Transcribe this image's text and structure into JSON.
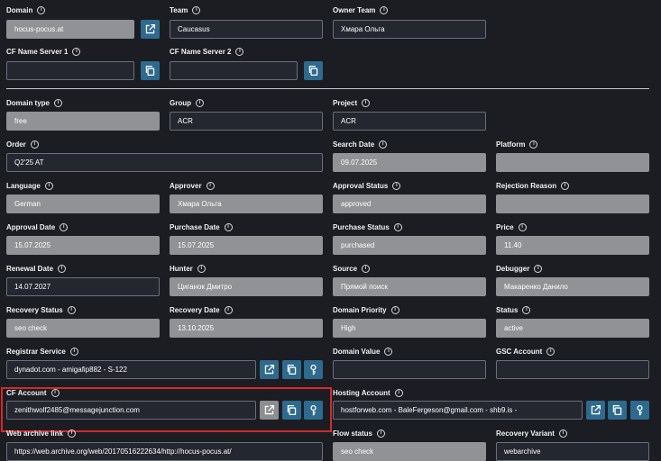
{
  "labels": {
    "domain": "Domain",
    "team": "Team",
    "owner_team": "Owner Team",
    "cf_ns1": "CF Name Server 1",
    "cf_ns2": "CF Name Server 2",
    "domain_type": "Domain type",
    "group": "Group",
    "project": "Project",
    "order": "Order",
    "search_date": "Search Date",
    "platform": "Platform",
    "language": "Language",
    "approver": "Approver",
    "approval_status": "Approval Status",
    "rejection_reason": "Rejection Reason",
    "approval_date": "Approval Date",
    "purchase_date": "Purchase Date",
    "purchase_status": "Purchase Status",
    "price": "Price",
    "renewal_date": "Renewal Date",
    "hunter": "Hunter",
    "source": "Source",
    "debugger": "Debugger",
    "recovery_status": "Recovery Status",
    "recovery_date": "Recovery Date",
    "domain_priority": "Domain Priority",
    "status": "Status",
    "registrar_service": "Registrar Service",
    "domain_value": "Domain Value",
    "gsc_account": "GSC Account",
    "cf_account": "CF Account",
    "hosting_account": "Hosting Account",
    "web_archive_link": "Web archive link",
    "flow_status": "Flow status",
    "recovery_variant": "Recovery Variant"
  },
  "values": {
    "domain": "hocus-pocus.at",
    "team": "Caucasus",
    "owner_team": "Хмара Ольга",
    "cf_ns1": "",
    "cf_ns2": "",
    "domain_type": "free",
    "group": "ACR",
    "project": "ACR",
    "order": "Q2'25 AT",
    "search_date": "09.07.2025",
    "platform": "",
    "language": "German",
    "approver": "Хмара Ольга",
    "approval_status": "approved",
    "rejection_reason": "",
    "approval_date": "15.07.2025",
    "purchase_date": "15.07.2025",
    "purchase_status": "purchased",
    "price": "11.40",
    "renewal_date": "14.07.2027",
    "hunter": "Циганок Дмитро",
    "source": "Прямой поиск",
    "debugger": "Макаренко Данило",
    "recovery_status": "seo check",
    "recovery_date": "13.10.2025",
    "domain_priority": "High",
    "status": "active",
    "registrar_service": "dynadot.com - amigafip882 - S-122",
    "domain_value": "",
    "gsc_account": "",
    "cf_account": "zenithwolf2485@messagejunction.com",
    "hosting_account": "hostforweb.com - BaleFergeson@gmail.com - shb9.is -",
    "web_archive_link": "https://web.archive.org/web/20170516222634/http://hocus-pocus.at/",
    "flow_status": "seo check",
    "recovery_variant": "webarchive"
  },
  "colors": {
    "accent_button": "#2e6a8e",
    "highlight": "#d42a2a"
  }
}
